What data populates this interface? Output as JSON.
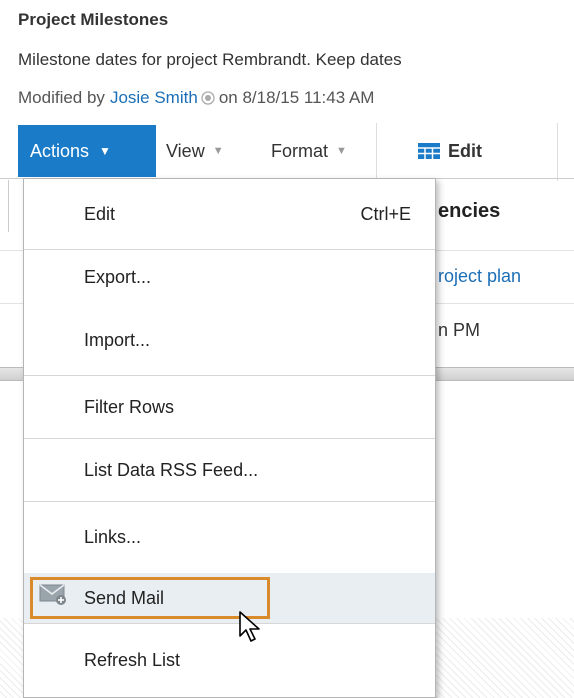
{
  "header": {
    "title": "Project Milestones",
    "description": "Milestone dates for project Rembrandt. Keep dates",
    "modified_prefix": "Modified by",
    "modified_user": "Josie Smith",
    "modified_suffix": "on 8/18/15 11:43 AM"
  },
  "toolbar": {
    "actions_label": "Actions",
    "view_label": "View",
    "format_label": "Format",
    "edit_label": "Edit"
  },
  "list": {
    "column_header": "encies",
    "row1_cell": "roject plan",
    "row2_cell": "n PM"
  },
  "menu": {
    "items": [
      {
        "label": "Edit",
        "shortcut": "Ctrl+E"
      },
      {
        "label": "Export..."
      },
      {
        "label": "Import..."
      },
      {
        "label": "Filter Rows"
      },
      {
        "label": "List Data RSS Feed..."
      },
      {
        "label": "Links..."
      },
      {
        "label": "Send Mail",
        "icon": "mail-icon",
        "highlighted": true
      },
      {
        "label": "Refresh List"
      }
    ]
  },
  "colors": {
    "accent": "#1a7cc9",
    "link": "#1c6fb6",
    "focus": "#d98a2b",
    "hover": "#e8eef1"
  }
}
